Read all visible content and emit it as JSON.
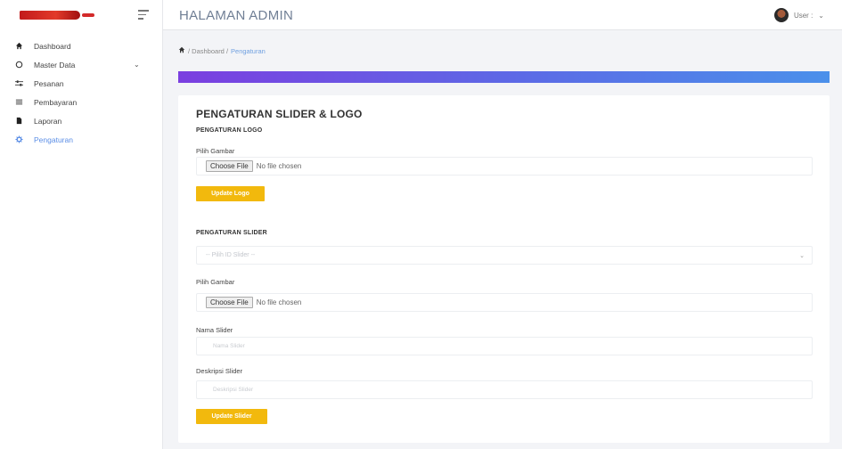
{
  "sidebar": {
    "items": [
      {
        "label": "Dashboard",
        "icon": "home-icon"
      },
      {
        "label": "Master Data",
        "icon": "circle-icon"
      },
      {
        "label": "Pesanan",
        "icon": "sliders-icon"
      },
      {
        "label": "Pembayaran",
        "icon": "list-icon"
      },
      {
        "label": "Laporan",
        "icon": "file-icon"
      },
      {
        "label": "Pengaturan",
        "icon": "gear-icon"
      }
    ]
  },
  "header": {
    "title": "HALAMAN ADMIN",
    "user_label": "User :"
  },
  "breadcrumb": {
    "path": "/ Dashboard /",
    "current": "Pengaturan"
  },
  "card": {
    "title": "PENGATURAN SLIDER & LOGO",
    "logo_section": {
      "title": "PENGATURAN LOGO",
      "image_label": "Pilih Gambar",
      "file_button": "Choose File",
      "file_status": "No file chosen",
      "submit": "Update Logo"
    },
    "slider_section": {
      "title": "PENGATURAN SLIDER",
      "select_placeholder": "-- Pilih ID Slider --",
      "image_label": "Pilih Gambar",
      "file_button": "Choose File",
      "file_status": "No file chosen",
      "name_label": "Nama Slider",
      "name_placeholder": "Nama Slider",
      "desc_label": "Deskripsi Slider",
      "desc_placeholder": "Deskripsi Slider",
      "submit": "Update Slider"
    }
  },
  "colors": {
    "accent_yellow": "#f2b90d",
    "active_nav": "#5b8ee6",
    "gradient_start": "#7b3fe0",
    "gradient_end": "#4b90ea"
  }
}
